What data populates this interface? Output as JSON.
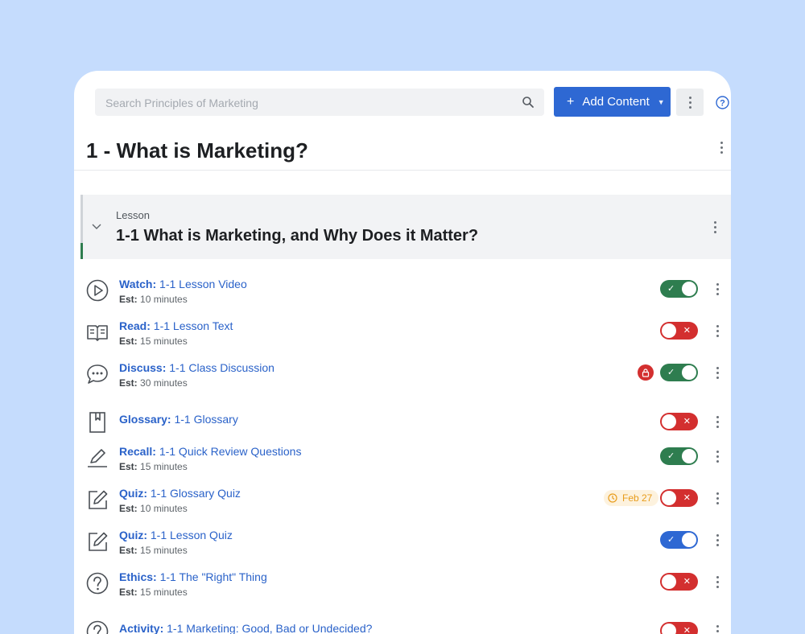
{
  "search": {
    "placeholder": "Search Principles of Marketing"
  },
  "toolbar": {
    "add_label": "Add Content",
    "add_plus": "+",
    "help": "?"
  },
  "page": {
    "title": "1 - What is Marketing?"
  },
  "lesson": {
    "type": "Lesson",
    "title": "1-1 What is Marketing, and Why Does it Matter?"
  },
  "est_label": "Est:",
  "colors": {
    "on_green": "#2e7d4f",
    "on_blue": "#2e68d3",
    "off_red": "#d32f2f",
    "link": "#2a62c9"
  },
  "items": [
    {
      "icon": "play-circle-icon",
      "type": "Watch:",
      "name": "1-1 Lesson Video",
      "est": "10 minutes",
      "toggle": "on",
      "toggle_color": "green"
    },
    {
      "icon": "book-open-icon",
      "type": "Read:",
      "name": "1-1 Lesson Text",
      "est": "15 minutes",
      "toggle": "off",
      "toggle_color": "red"
    },
    {
      "icon": "chat-bubbles-icon",
      "type": "Discuss:",
      "name": "1-1 Class Discussion",
      "est": "30 minutes",
      "toggle": "on",
      "toggle_color": "green",
      "locked": true
    },
    {
      "icon": "bookmark-page-icon",
      "type": "Glossary:",
      "name": "1-1 Glossary",
      "est": "",
      "toggle": "off",
      "toggle_color": "red"
    },
    {
      "icon": "pencil-line-icon",
      "type": "Recall:",
      "name": "1-1 Quick Review Questions",
      "est": "15 minutes",
      "toggle": "on",
      "toggle_color": "green"
    },
    {
      "icon": "edit-square-icon",
      "type": "Quiz:",
      "name": "1-1 Glossary Quiz",
      "est": "10 minutes",
      "toggle": "off",
      "toggle_color": "red",
      "due": "Feb 27"
    },
    {
      "icon": "edit-square-icon",
      "type": "Quiz:",
      "name": "1-1 Lesson Quiz",
      "est": "15 minutes",
      "toggle": "on",
      "toggle_color": "blue"
    },
    {
      "icon": "question-circle-icon",
      "type": "Ethics:",
      "name": "1-1 The \"Right\" Thing",
      "est": "15 minutes",
      "toggle": "off",
      "toggle_color": "red"
    },
    {
      "icon": "question-circle-icon",
      "type": "Activity:",
      "name": "1-1 Marketing: Good, Bad or Undecided?",
      "est": "",
      "toggle": "off",
      "toggle_color": "red"
    }
  ]
}
